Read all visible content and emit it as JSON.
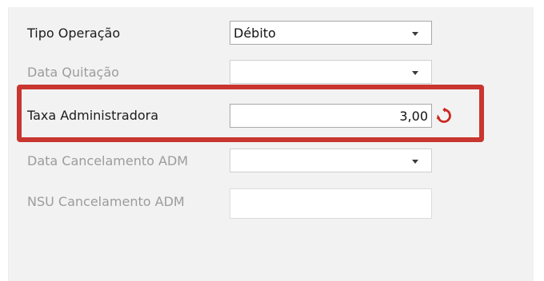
{
  "form": {
    "tipo_operacao": {
      "label": "Tipo Operação",
      "value": "Débito"
    },
    "data_quitacao": {
      "label": "Data Quitação",
      "value": ""
    },
    "taxa_administradora": {
      "label": "Taxa Administradora",
      "value": "3,00"
    },
    "data_cancelamento_adm": {
      "label": "Data Cancelamento ADM",
      "value": ""
    },
    "nsu_cancelamento_adm": {
      "label": "NSU Cancelamento ADM",
      "value": ""
    }
  },
  "icons": {
    "refresh": "refresh-icon",
    "dropdown": "chevron-down-icon"
  },
  "colors": {
    "highlight": "#c9352f",
    "refresh_icon": "#c92a22",
    "disabled_label": "#9c9c9c"
  }
}
